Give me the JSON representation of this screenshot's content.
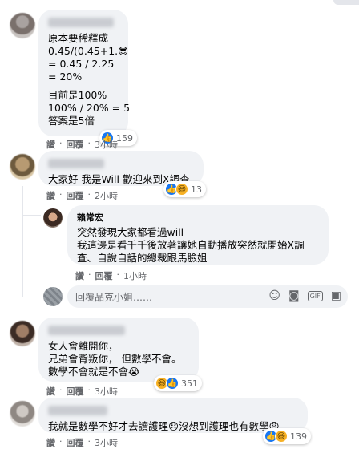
{
  "comments": [
    {
      "name": "",
      "lines": [
        "原本要稀釋成",
        "0.45/(0.45+1.😎",
        "= 0.45 / 2.25",
        "= 20%",
        "",
        "目前是100%",
        "100% / 20% = 5",
        "答案是5倍"
      ],
      "reactions": {
        "count": "159"
      },
      "meta": {
        "like": "讚",
        "reply": "回覆",
        "time": "3小時"
      }
    },
    {
      "name": "",
      "lines": [
        "大家好 我是Will 歡迎來到X調查"
      ],
      "reactions": {
        "count": "13"
      },
      "meta": {
        "like": "讚",
        "reply": "回覆",
        "time": "2小時"
      }
    },
    {
      "name": "賴常宏",
      "lines": [
        "突然發現大家都看過will",
        "我這邊是看千千後放著讓她自動播放突然就開始X調",
        "查、自說自話的總裁跟馬臉姐"
      ],
      "meta": {
        "like": "讚",
        "reply": "回覆",
        "time": "1小時"
      }
    },
    {
      "name": "",
      "lines": [
        "女人會離開你，",
        "兄弟會背叛你， 但數學不會。",
        "數學不會就是不會😭"
      ],
      "reactions": {
        "count": "351"
      },
      "meta": {
        "like": "讚",
        "reply": "回覆",
        "time": "3小時"
      }
    },
    {
      "name": "",
      "lines": [
        "我就是數學不好才去讀護理😞沒想到護理也有數學😩"
      ],
      "reactions": {
        "count": "139"
      },
      "meta": {
        "like": "讚",
        "reply": "回覆",
        "time": "3小時"
      }
    }
  ],
  "reply_box": {
    "placeholder": "回覆品克小姐……",
    "icons": [
      "smiley-icon",
      "camera-icon",
      "gif-icon",
      "sticker-icon"
    ]
  },
  "colors": {
    "bubble": "#f0f2f5",
    "like": "#1877f2",
    "meta_text": "#65676b"
  }
}
